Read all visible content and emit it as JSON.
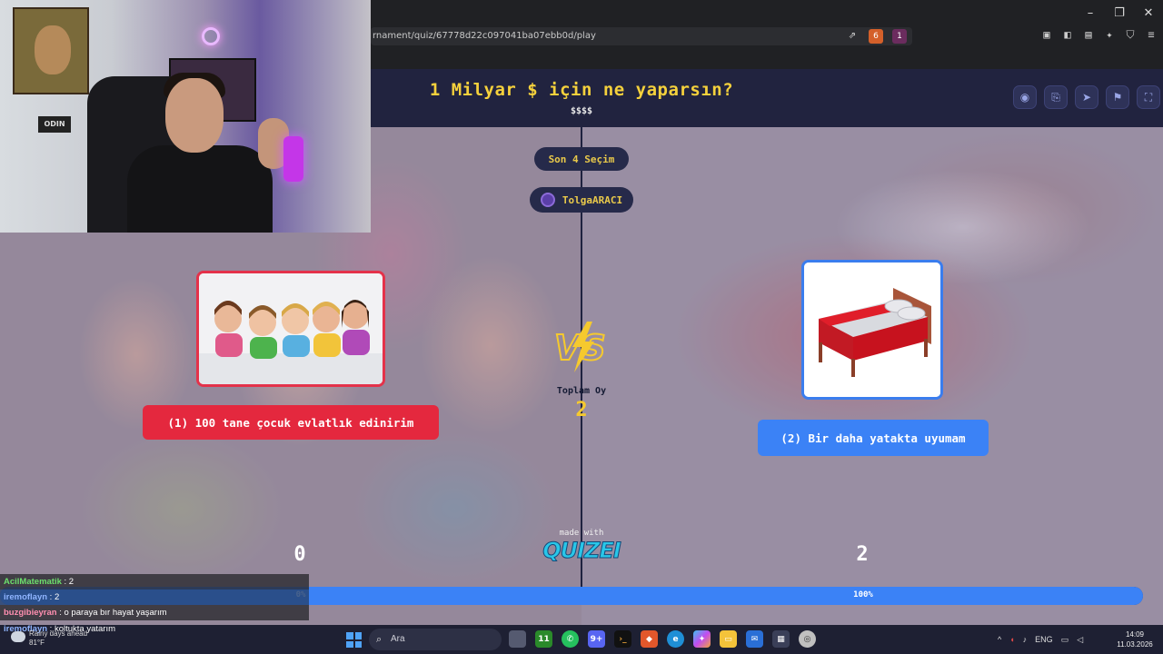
{
  "browser": {
    "url": "rnament/quiz/67778d22c097041ba07ebb0d/play",
    "win_minimize": "–",
    "win_restore": "❐",
    "win_close": "✕",
    "brave_shield_badge": "6",
    "rewards_badge": "1"
  },
  "quiz": {
    "title": "1 Milyar $ için ne yaparsın?",
    "subtitle": "$$$$",
    "last_choices_label": "Son 4 Seçim",
    "username": "TolgaARACI",
    "total_votes_label": "Toplam Oy",
    "total_votes": "2",
    "made_with": "made with",
    "brand": "QUIZEI",
    "option1": {
      "label": "(1) 100 tane çocuk evlatlık edinirim",
      "votes": "0",
      "percent_label": "0%",
      "fraction": 0.0,
      "color": "#e4283e"
    },
    "option2": {
      "label": "(2) Bir daha yatakta uyumam",
      "votes": "2",
      "percent_label": "100%",
      "fraction": 1.0,
      "color": "#3b82f6"
    },
    "header_icons": [
      "eye-icon",
      "share-icon",
      "send-icon",
      "flag-icon",
      "fullscreen-icon"
    ]
  },
  "webcam": {
    "sign_text": "ODIN"
  },
  "chat": [
    {
      "user": "AcilMatematik",
      "message": " : 2",
      "user_color": "#6ce06c"
    },
    {
      "user": "iremoflayn",
      "message": " : 2",
      "user_color": "#8fb4ff"
    },
    {
      "user": "buzgibieyran",
      "message": " : o paraya bır hayat yaşarım",
      "user_color": "#ff8fb0"
    },
    {
      "user": "iremoflayn",
      "message": " : koltukta yatarım",
      "user_color": "#8fb4ff"
    }
  ],
  "taskbar": {
    "weather_line1": "Rainy days ahead",
    "weather_line2": "81°F",
    "search_placeholder": "Ara",
    "language": "ENG",
    "time": "14:09",
    "date": "11.03.2026",
    "teams_badge": "11",
    "discord_badge": "9+"
  },
  "colors": {
    "accent_yellow": "#f5d13c",
    "header_bg": "#21233f",
    "progress_blue": "#3b82f6"
  }
}
